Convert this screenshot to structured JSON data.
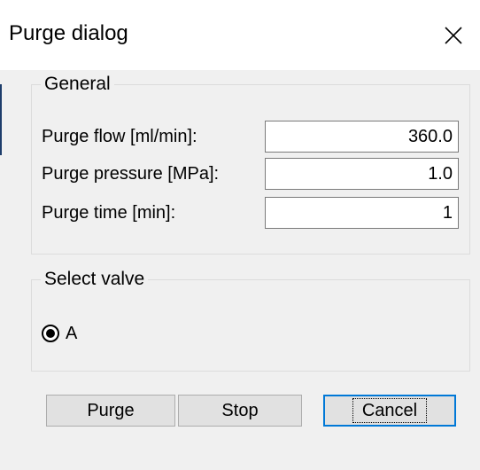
{
  "window": {
    "title": "Purge dialog",
    "close_icon": "close-icon"
  },
  "general": {
    "legend": "General",
    "fields": [
      {
        "label": "Purge flow [ml/min]:",
        "value": "360.0"
      },
      {
        "label": "Purge pressure [MPa]:",
        "value": "1.0"
      },
      {
        "label": "Purge time [min]:",
        "value": "1"
      }
    ]
  },
  "valve": {
    "legend": "Select valve",
    "options": [
      {
        "label": "A",
        "selected": true
      }
    ]
  },
  "buttons": {
    "purge": "Purge",
    "stop": "Stop",
    "cancel": "Cancel"
  },
  "colors": {
    "dialog_bg": "#f0f0f0",
    "titlebar_bg": "#ffffff",
    "button_bg": "#e1e1e1",
    "default_button_border": "#0078d7"
  }
}
